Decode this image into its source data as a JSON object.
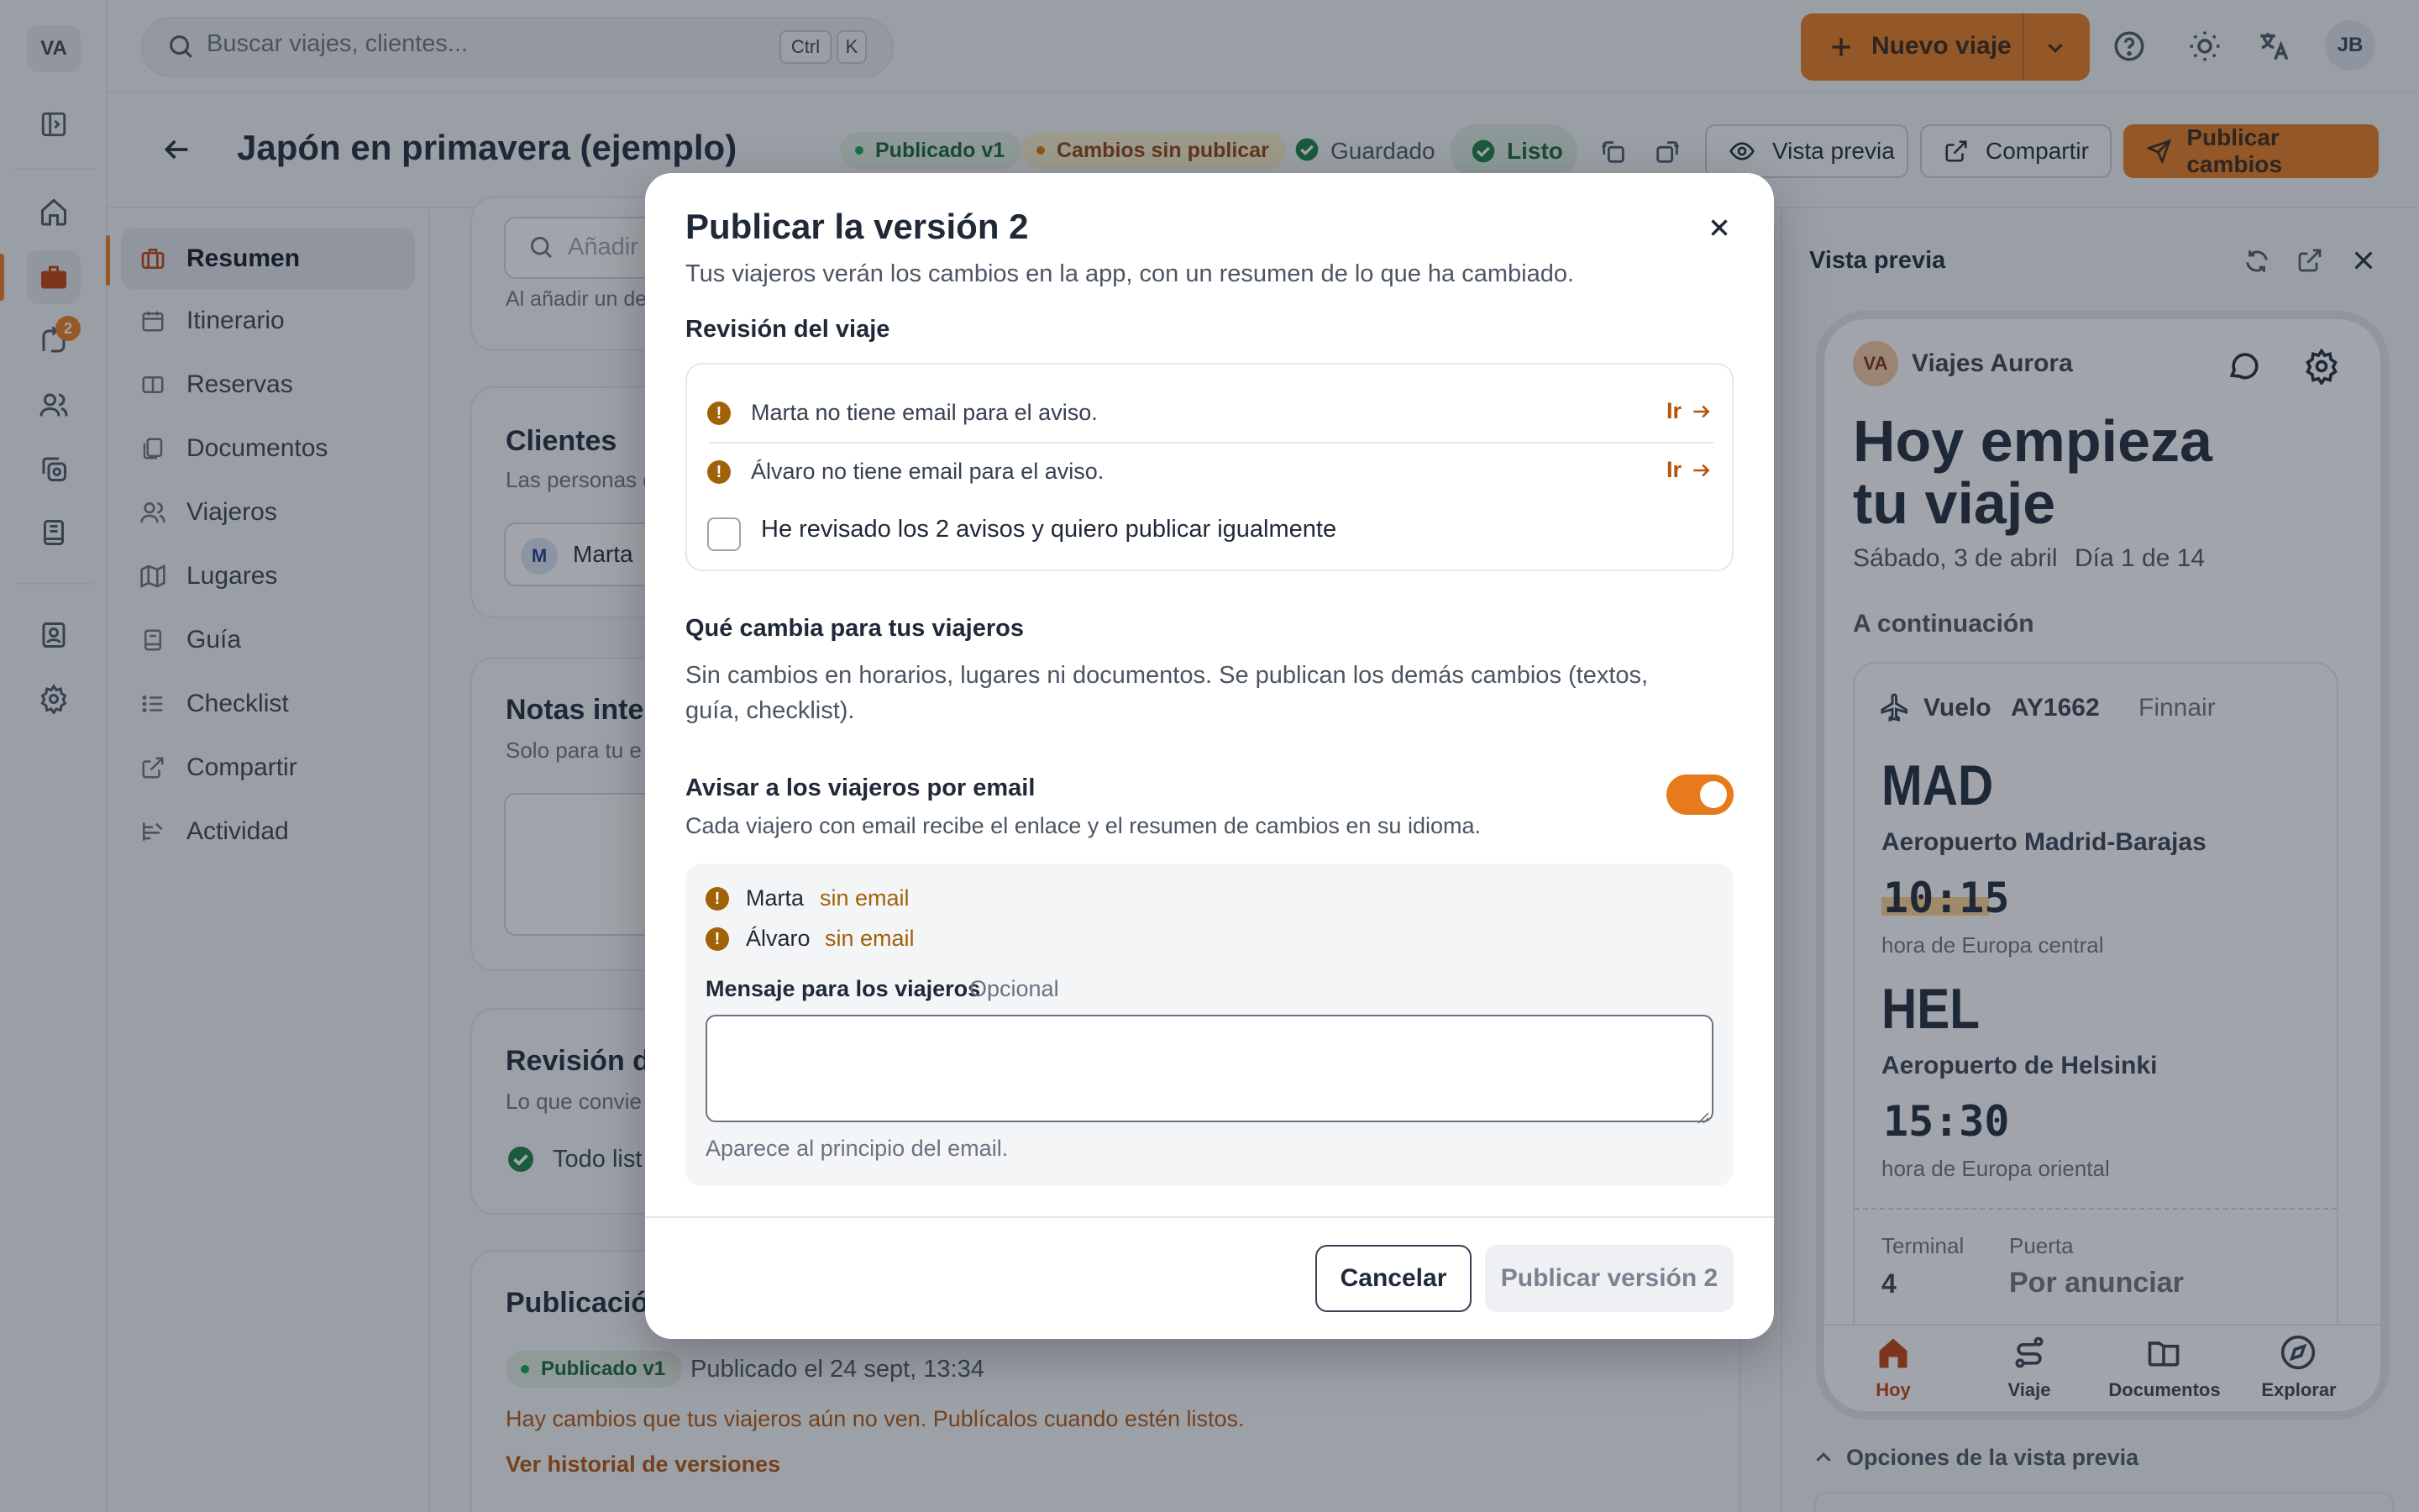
{
  "rail": {
    "logo": "VA",
    "badge": "2"
  },
  "topbar": {
    "search_placeholder": "Buscar viajes, clientes...",
    "kbd_ctrl": "Ctrl",
    "kbd_k": "K",
    "new_trip": "Nuevo viaje",
    "avatar": "JB"
  },
  "trip": {
    "title": "Japón en primavera (ejemplo)",
    "status_published": "Publicado v1",
    "status_unpublished": "Cambios sin publicar",
    "saved": "Guardado",
    "ready": "Listo",
    "preview_btn": "Vista previa",
    "share_btn": "Compartir",
    "publish_btn": "Publicar cambios"
  },
  "nav": {
    "items": [
      {
        "label": "Resumen",
        "icon": "suitcase-icon"
      },
      {
        "label": "Itinerario",
        "icon": "calendar-icon"
      },
      {
        "label": "Reservas",
        "icon": "ticket-icon"
      },
      {
        "label": "Documentos",
        "icon": "documents-icon"
      },
      {
        "label": "Viajeros",
        "icon": "users-icon"
      },
      {
        "label": "Lugares",
        "icon": "map-icon"
      },
      {
        "label": "Guía",
        "icon": "book-icon"
      },
      {
        "label": "Checklist",
        "icon": "list-icon"
      },
      {
        "label": "Compartir",
        "icon": "share-icon"
      },
      {
        "label": "Actividad",
        "icon": "activity-icon"
      }
    ]
  },
  "main": {
    "add_placeholder": "Añadir",
    "add_hint": "Al añadir un de",
    "clients_title": "Clientes",
    "clients_sub": "Las personas d",
    "client_chip_initial": "M",
    "client_chip_name": "Marta",
    "notes_title": "Notas inter",
    "notes_sub": "Solo para tu e",
    "review_title": "Revisión de",
    "review_sub": "Lo que convie",
    "review_ok": "Todo list",
    "pub_title": "Publicación",
    "pub_badge": "Publicado v1",
    "pub_date": "Publicado el 24 sept, 13:34",
    "pub_notice": "Hay cambios que tus viajeros aún no ven. Publícalos cuando estén listos.",
    "pub_history": "Ver historial de versiones"
  },
  "preview": {
    "title": "Vista previa",
    "agency_initials": "VA",
    "agency": "Viajes Aurora",
    "hero_line1": "Hoy empieza",
    "hero_line2": "tu viaje",
    "date": "Sábado, 3 de abril",
    "day": "Día 1 de 14",
    "next": "A continuación",
    "flight_label": "Vuelo",
    "flight_no": "AY1662",
    "airline": "Finnair",
    "from_code": "MAD",
    "from_airport": "Aeropuerto Madrid-Barajas",
    "from_time": "10:15",
    "from_tz": "hora de Europa central",
    "to_code": "HEL",
    "to_airport": "Aeropuerto de Helsinki",
    "to_time": "15:30",
    "to_tz": "hora de Europa oriental",
    "terminal_label": "Terminal",
    "terminal_value": "4",
    "gate_label": "Puerta",
    "gate_value": "Por anunciar",
    "tabs": [
      "Hoy",
      "Viaje",
      "Documentos",
      "Explorar"
    ],
    "options": "Opciones de la vista previa"
  },
  "modal": {
    "title": "Publicar la versión 2",
    "subtitle": "Tus viajeros verán los cambios en la app, con un resumen de lo que ha cambiado.",
    "review_heading": "Revisión del viaje",
    "warnings": [
      {
        "text": "Marta no tiene email para el aviso.",
        "link": "Ir"
      },
      {
        "text": "Álvaro no tiene email para el aviso.",
        "link": "Ir"
      }
    ],
    "confirm_label": "He revisado los 2 avisos y quiero publicar igualmente",
    "changes_heading": "Qué cambia para tus viajeros",
    "changes_text_1": "Sin cambios en horarios, lugares ni documentos. Se publican los demás cambios (textos,",
    "changes_text_2": "guía, checklist).",
    "notify_heading": "Avisar a los viajeros por email",
    "notify_sub": "Cada viajero con email recibe el enlace y el resumen de cambios en su idioma.",
    "notify_on": true,
    "recipients": [
      {
        "name": "Marta",
        "status": "sin email"
      },
      {
        "name": "Álvaro",
        "status": "sin email"
      }
    ],
    "message_label": "Mensaje para los viajeros",
    "message_optional": "Opcional",
    "message_value": "",
    "message_hint": "Aparece al principio del email.",
    "cancel": "Cancelar",
    "publish": "Publicar versión 2"
  }
}
